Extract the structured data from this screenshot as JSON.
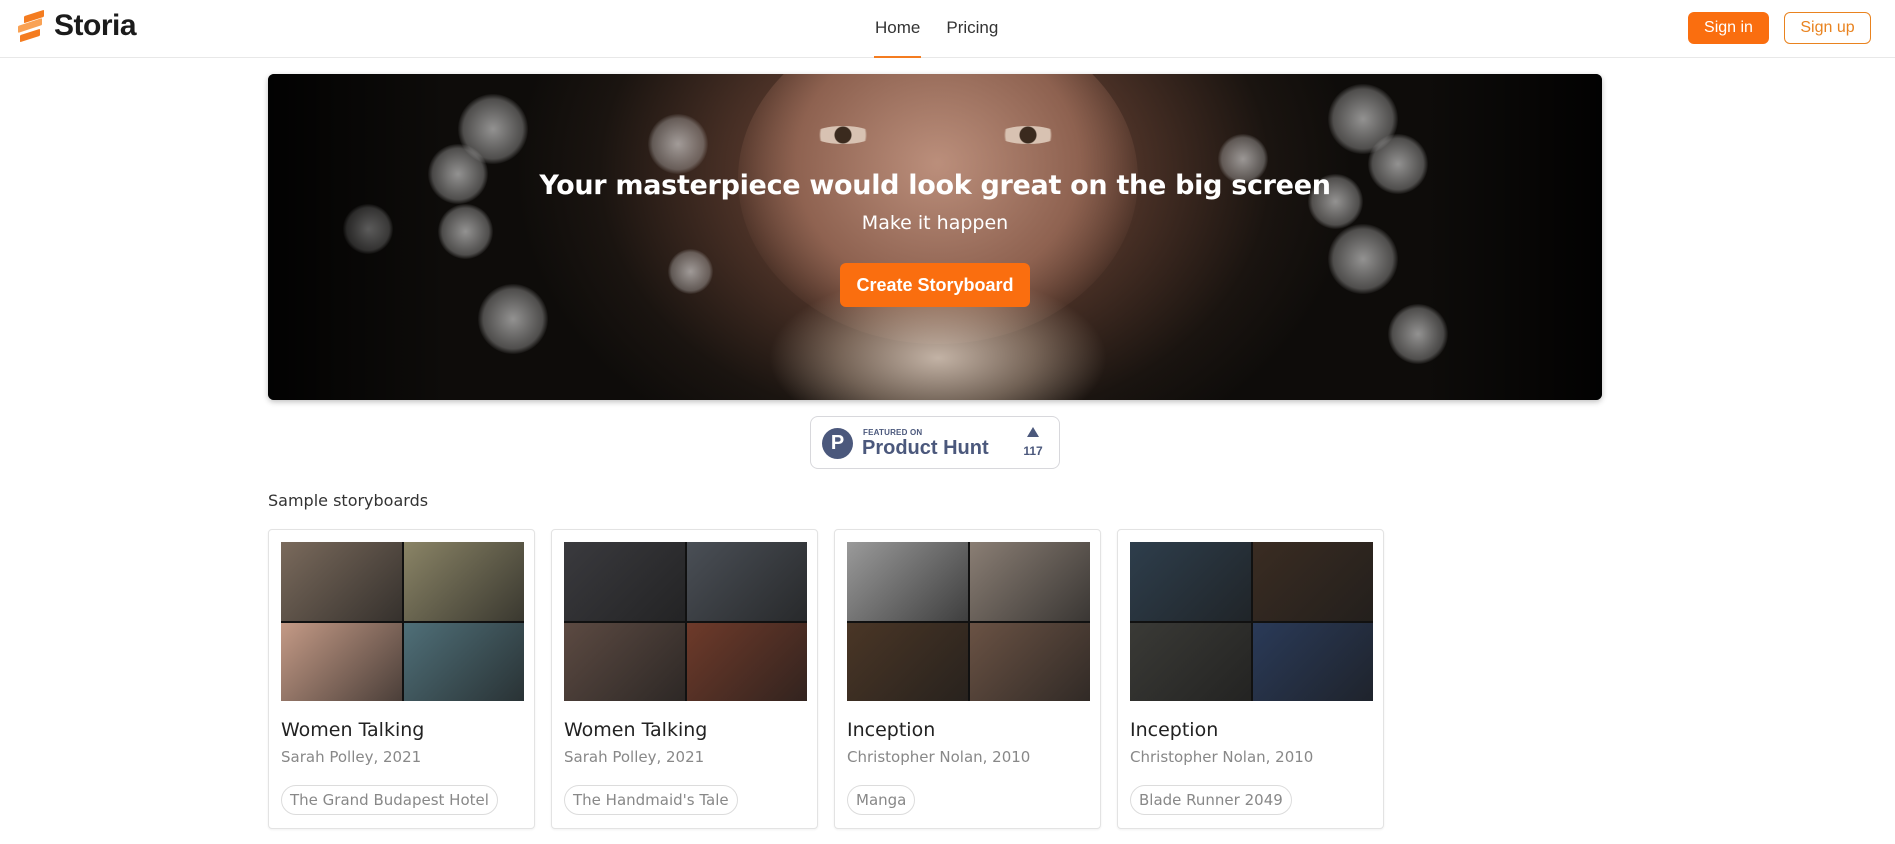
{
  "header": {
    "logo_text": "Storia",
    "nav": [
      {
        "label": "Home",
        "active": true
      },
      {
        "label": "Pricing",
        "active": false
      }
    ],
    "signin_label": "Sign in",
    "signup_label": "Sign up"
  },
  "hero": {
    "title": "Your masterpiece would look great on the big screen",
    "subtitle": "Make it happen",
    "cta_label": "Create Storyboard"
  },
  "product_hunt": {
    "featured_label": "FEATURED ON",
    "name": "Product Hunt",
    "logo_letter": "P",
    "votes": "117"
  },
  "samples": {
    "title": "Sample storyboards",
    "cards": [
      {
        "title": "Women Talking",
        "subtitle": "Sarah Polley, 2021",
        "tag": "The Grand Budapest Hotel",
        "thumb_colors": [
          "#7a6a5c",
          "#8a8466",
          "#c49a86",
          "#4f6f78"
        ]
      },
      {
        "title": "Women Talking",
        "subtitle": "Sarah Polley, 2021",
        "tag": "The Handmaid's Tale",
        "thumb_colors": [
          "#3a3a3e",
          "#4a4f56",
          "#5c4a42",
          "#6e3a2a"
        ]
      },
      {
        "title": "Inception",
        "subtitle": "Christopher Nolan, 2010",
        "tag": "Manga",
        "thumb_colors": [
          "#9a9a9a",
          "#8a7e74",
          "#4a3626",
          "#6a5244"
        ]
      },
      {
        "title": "Inception",
        "subtitle": "Christopher Nolan, 2010",
        "tag": "Blade Runner 2049",
        "thumb_colors": [
          "#2e3e4c",
          "#3a2c22",
          "#3a3a36",
          "#2a3a58"
        ]
      }
    ]
  },
  "colors": {
    "accent": "#fa6e0f",
    "outline_accent": "#e9831f",
    "ph_blue": "#4b587c"
  }
}
